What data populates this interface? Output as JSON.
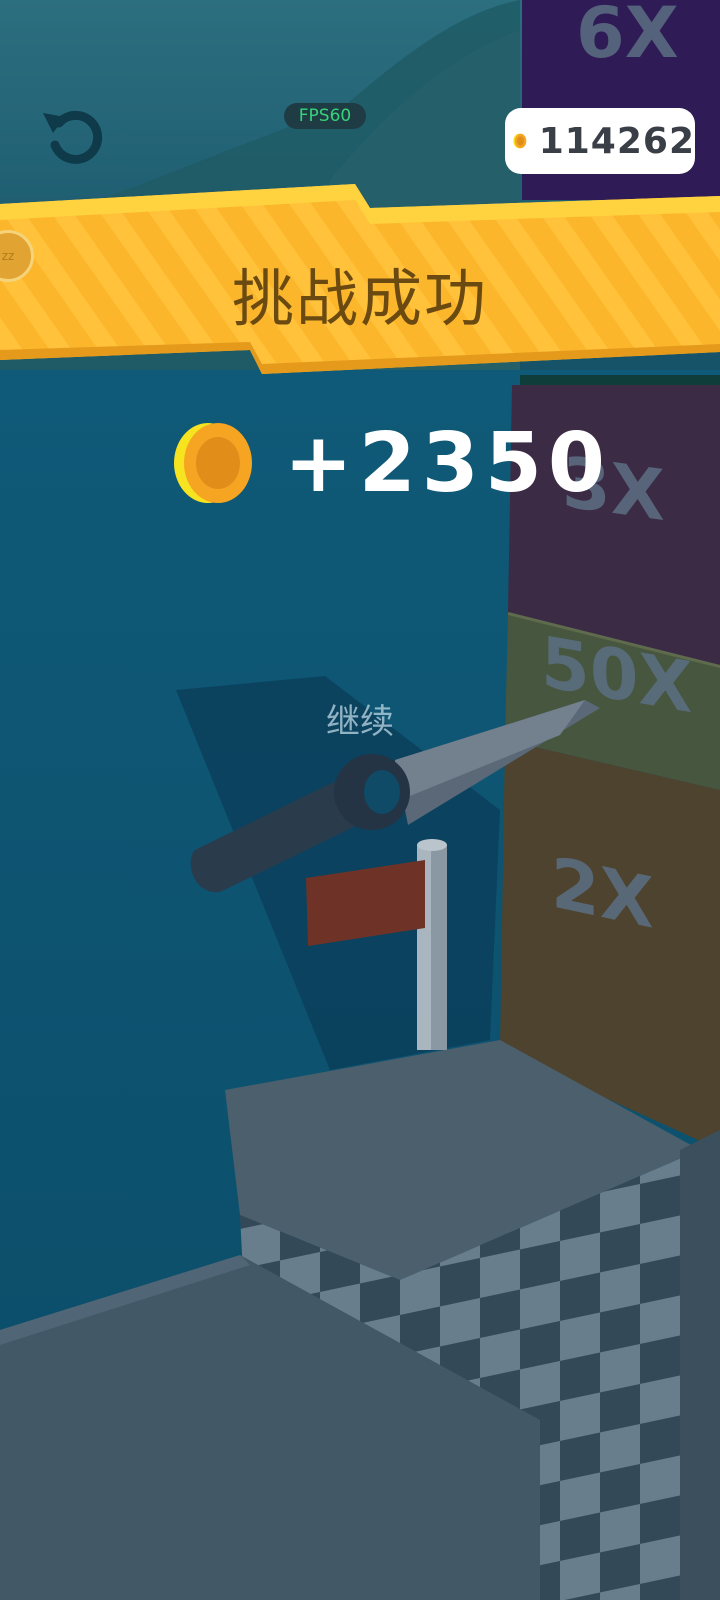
{
  "hud": {
    "fps_label": "FPS60",
    "coin_total": "114262",
    "restart_icon": "restart-icon",
    "coin_icon": "coin-icon"
  },
  "banner": {
    "title": "挑战成功",
    "colors": {
      "primary": "#fbb62c",
      "highlight": "#ffd23f",
      "text": "#6b4a12"
    }
  },
  "reward": {
    "amount": "+2350",
    "coin_icon": "coin-icon"
  },
  "continue_label": "继续",
  "multipliers": [
    {
      "label": "6X",
      "color": "#2f1b55"
    },
    {
      "label": "3X",
      "color": "#3c2b45"
    },
    {
      "label": "50X",
      "color": "#47563f"
    },
    {
      "label": "2X",
      "color": "#4d432f"
    }
  ]
}
